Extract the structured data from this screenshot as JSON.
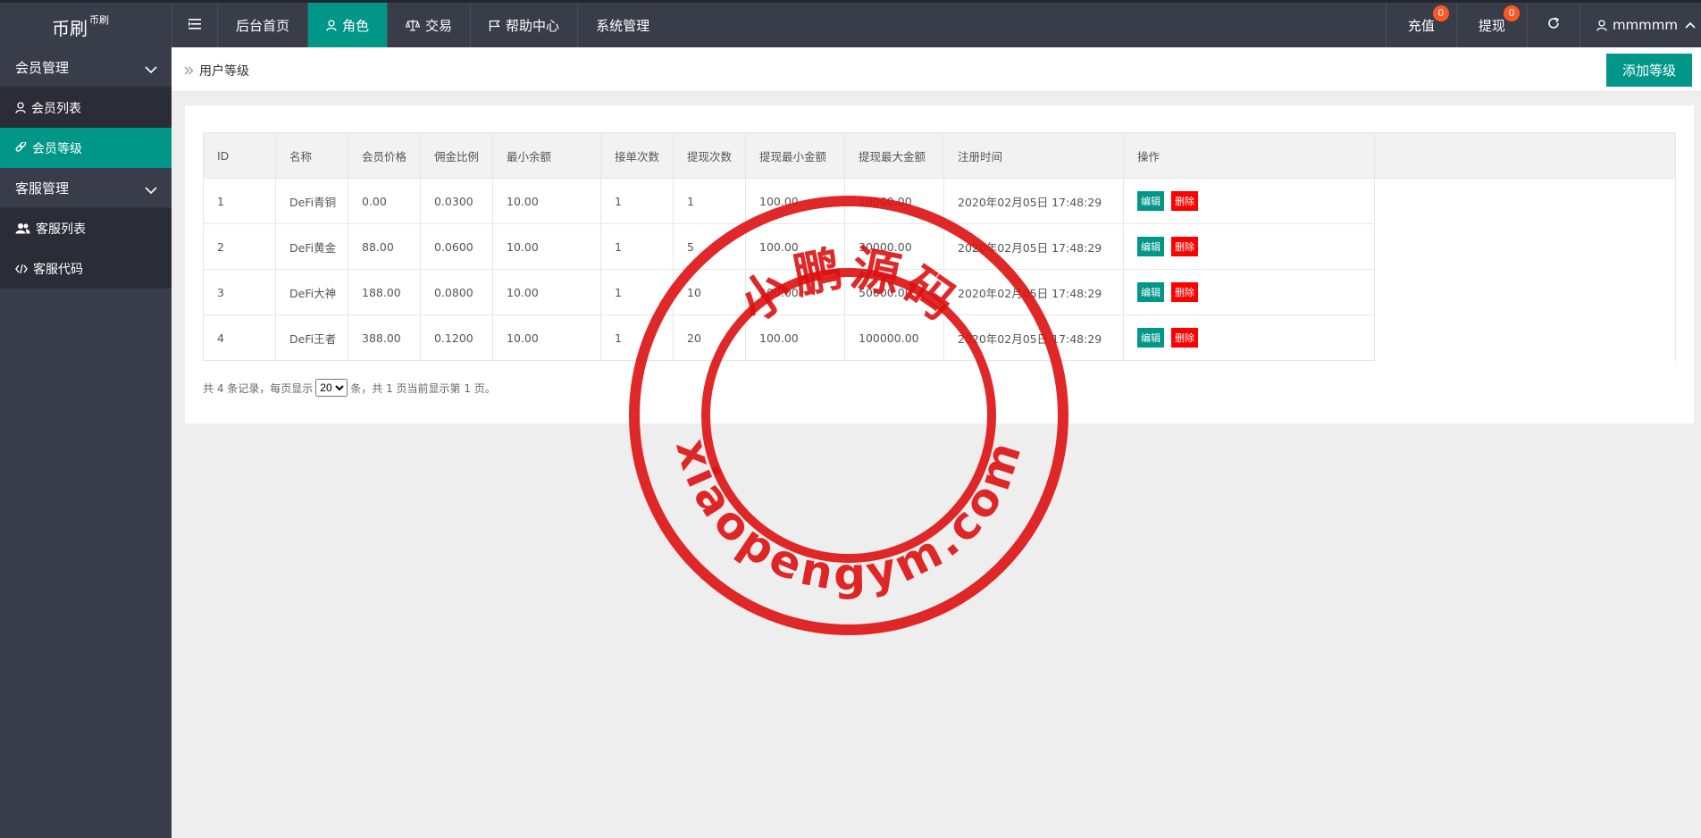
{
  "logo": {
    "title": "币刷",
    "sub": "币刷"
  },
  "nav": [
    {
      "label": "后台首页"
    },
    {
      "label": "角色"
    },
    {
      "label": "交易"
    },
    {
      "label": "帮助中心"
    },
    {
      "label": "系统管理"
    }
  ],
  "nav_right": {
    "recharge": {
      "label": "充值",
      "badge": "0"
    },
    "withdraw": {
      "label": "提现",
      "badge": "0"
    },
    "user": "mmmmm"
  },
  "sidebar": {
    "group1": "会员管理",
    "item_member_list": "会员列表",
    "item_member_level": "会员等级",
    "group2": "客服管理",
    "item_cs_list": "客服列表",
    "item_cs_code": "客服代码"
  },
  "breadcrumb": "用户等级",
  "add_button": "添加等级",
  "table": {
    "headers": [
      "ID",
      "名称",
      "会员价格",
      "佣金比例",
      "最小余额",
      "接单次数",
      "提现次数",
      "提现最小金额",
      "提现最大金额",
      "注册时间",
      "操作"
    ],
    "rows": [
      [
        "1",
        "DeFi青铜",
        "0.00",
        "0.0300",
        "10.00",
        "1",
        "1",
        "100.00",
        "10000.00",
        "2020年02月05日 17:48:29"
      ],
      [
        "2",
        "DeFi黄金",
        "88.00",
        "0.0600",
        "10.00",
        "1",
        "5",
        "100.00",
        "30000.00",
        "2020年02月05日 17:48:29"
      ],
      [
        "3",
        "DeFi大神",
        "188.00",
        "0.0800",
        "10.00",
        "1",
        "10",
        "100.00",
        "50000.00",
        "2020年02月05日 17:48:29"
      ],
      [
        "4",
        "DeFi王者",
        "388.00",
        "0.1200",
        "10.00",
        "1",
        "20",
        "100.00",
        "100000.00",
        "2020年02月05日 17:48:29"
      ]
    ],
    "edit_label": "编辑",
    "delete_label": "删除"
  },
  "pager": {
    "prefix": "共 4 条记录，每页显示",
    "page_size": "20",
    "suffix": "条，共 1 页当前显示第 1 页。"
  },
  "watermark": {
    "top_text": "小鹏源码",
    "bottom_text": "xiaopengym.com",
    "color": "#dd1111"
  },
  "colors": {
    "accent": "#009688",
    "header": "#393d49",
    "badge": "#ff5722",
    "danger": "#ff0000"
  }
}
